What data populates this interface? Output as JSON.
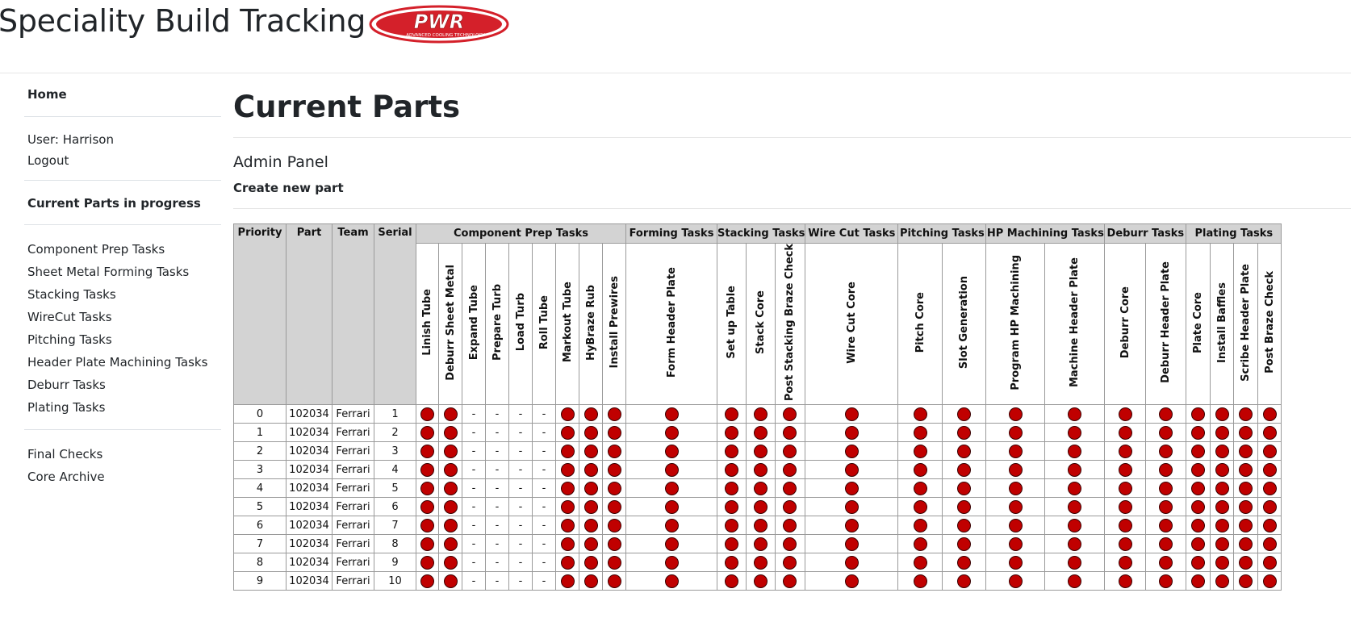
{
  "app": {
    "title": "Speciality Build Tracking",
    "logo_text": "PWR",
    "logo_subtext": "ADVANCED COOLING TECHNOLOGY"
  },
  "colors": {
    "status_incomplete": "#c00000",
    "header_bg": "#d3d3d3",
    "logo_red": "#d4202a"
  },
  "sidebar": {
    "home": "Home",
    "user": "User: Harrison",
    "logout": "Logout",
    "current_parts": "Current Parts in progress",
    "tasks": [
      "Component Prep Tasks",
      "Sheet Metal Forming Tasks",
      "Stacking Tasks",
      "WireCut Tasks",
      "Pitching Tasks",
      "Header Plate Machining Tasks",
      "Deburr Tasks",
      "Plating Tasks"
    ],
    "final_checks": "Final Checks",
    "core_archive": "Core Archive"
  },
  "main": {
    "title": "Current Parts",
    "admin_panel": "Admin Panel",
    "create_new_part": "Create new part"
  },
  "table": {
    "fixed_columns": [
      "Priority",
      "Part",
      "Team",
      "Serial"
    ],
    "groups": [
      {
        "label": "Component Prep Tasks",
        "tasks": [
          "Linish Tube",
          "Deburr Sheet Metal",
          "Expand Tube",
          "Prepare Turb",
          "Load Turb",
          "Roll Tube",
          "Markout Tube",
          "HyBraze Rub",
          "Install Prewires"
        ]
      },
      {
        "label": "Forming Tasks",
        "tasks": [
          "Form Header Plate"
        ]
      },
      {
        "label": "Stacking Tasks",
        "tasks": [
          "Set up Table",
          "Stack Core",
          "Post Stacking Braze Check"
        ]
      },
      {
        "label": "Wire Cut Tasks",
        "tasks": [
          "Wire Cut Core"
        ]
      },
      {
        "label": "Pitching Tasks",
        "tasks": [
          "Pitch Core",
          "Slot Generation"
        ]
      },
      {
        "label": "HP Machining Tasks",
        "tasks": [
          "Program HP Machining",
          "Machine Header Plate"
        ]
      },
      {
        "label": "Deburr Tasks",
        "tasks": [
          "Deburr Core",
          "Deburr Header Plate"
        ]
      },
      {
        "label": "Plating Tasks",
        "tasks": [
          "Plate Core",
          "Install Baffles",
          "Scribe Header Plate",
          "Post Braze Check"
        ]
      }
    ],
    "status_pattern": [
      "dot",
      "dot",
      "-",
      "-",
      "-",
      "-",
      "dot",
      "dot",
      "dot",
      "dot",
      "dot",
      "dot",
      "dot",
      "dot",
      "dot",
      "dot",
      "dot",
      "dot",
      "dot",
      "dot",
      "dot",
      "dot",
      "dot",
      "dot"
    ],
    "rows": [
      {
        "priority": "0",
        "part": "102034",
        "team": "Ferrari",
        "serial": "1"
      },
      {
        "priority": "1",
        "part": "102034",
        "team": "Ferrari",
        "serial": "2"
      },
      {
        "priority": "2",
        "part": "102034",
        "team": "Ferrari",
        "serial": "3"
      },
      {
        "priority": "3",
        "part": "102034",
        "team": "Ferrari",
        "serial": "4"
      },
      {
        "priority": "4",
        "part": "102034",
        "team": "Ferrari",
        "serial": "5"
      },
      {
        "priority": "5",
        "part": "102034",
        "team": "Ferrari",
        "serial": "6"
      },
      {
        "priority": "6",
        "part": "102034",
        "team": "Ferrari",
        "serial": "7"
      },
      {
        "priority": "7",
        "part": "102034",
        "team": "Ferrari",
        "serial": "8"
      },
      {
        "priority": "8",
        "part": "102034",
        "team": "Ferrari",
        "serial": "9"
      },
      {
        "priority": "9",
        "part": "102034",
        "team": "Ferrari",
        "serial": "10"
      }
    ]
  }
}
